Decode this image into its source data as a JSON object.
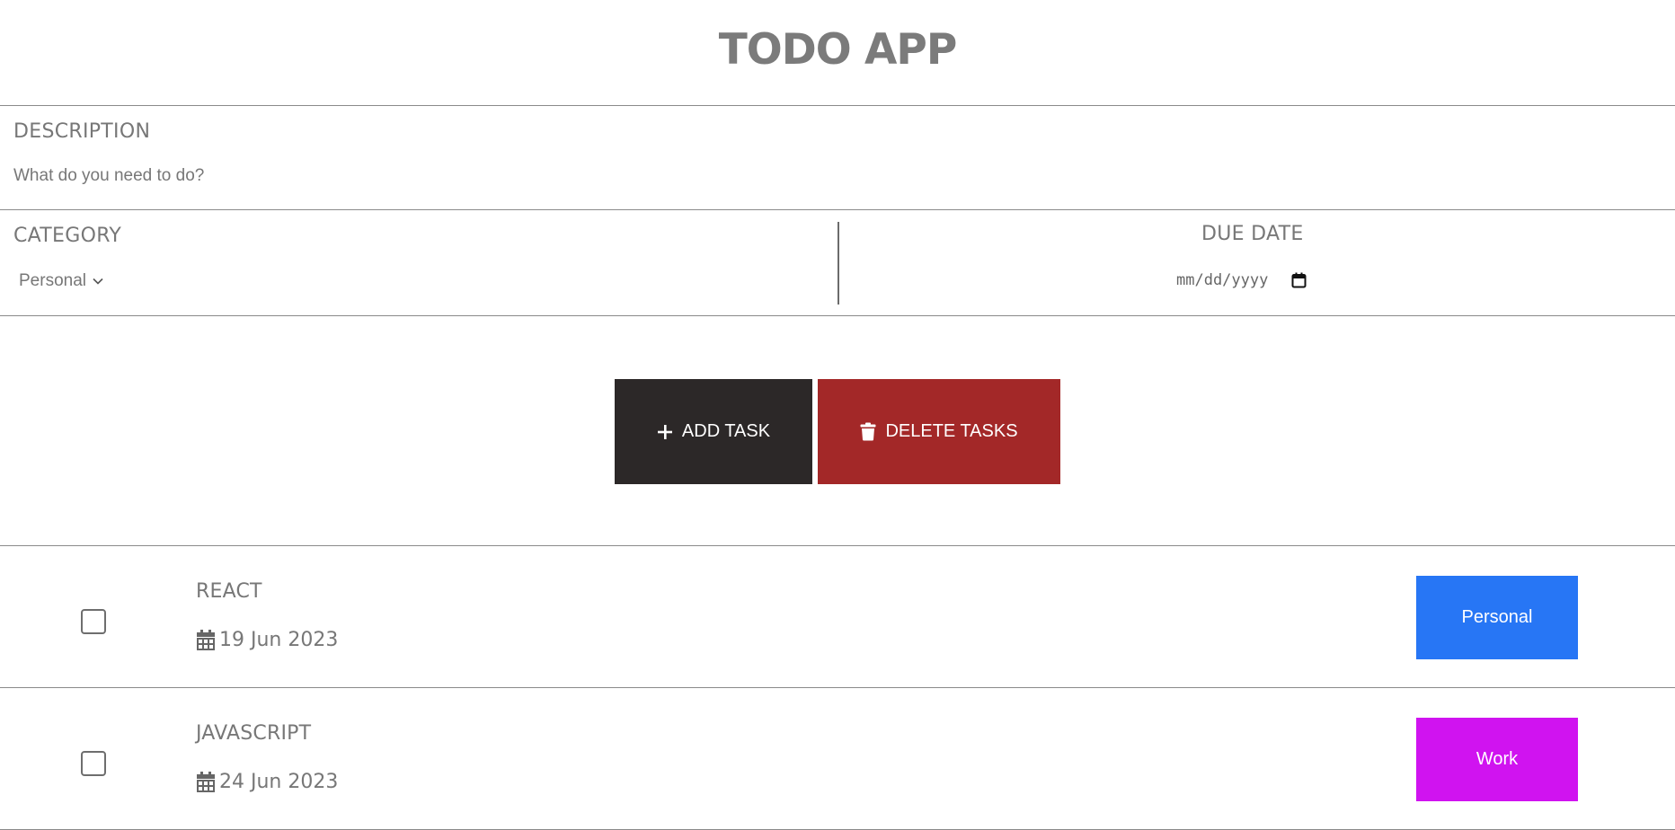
{
  "app": {
    "title": "TODO APP"
  },
  "form": {
    "description_label": "DESCRIPTION",
    "description_placeholder": "What do you need to do?",
    "category_label": "CATEGORY",
    "category_value": "Personal",
    "due_date_label": "DUE DATE",
    "due_date_placeholder": "mm/dd/yyyy"
  },
  "buttons": {
    "add_label": "ADD TASK",
    "delete_label": "DELETE TASKS"
  },
  "tasks": [
    {
      "name": "REACT",
      "date": "19 Jun 2023",
      "category": "Personal",
      "checked": false
    },
    {
      "name": "JAVASCRIPT",
      "date": "24 Jun 2023",
      "category": "Work",
      "checked": false
    }
  ],
  "colors": {
    "add_button": "#2c2828",
    "delete_button": "#a32828",
    "personal_badge": "#2776f5",
    "work_badge": "#d013f0"
  },
  "icons": [
    "plus-icon",
    "trash-icon",
    "calendar-icon",
    "chevron-down-icon"
  ]
}
